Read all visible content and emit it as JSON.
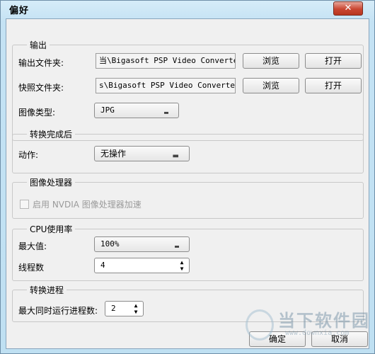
{
  "window": {
    "title": "偏好",
    "close_label": "✕"
  },
  "output": {
    "title": "输出",
    "output_folder_label": "输出文件夹:",
    "output_folder_value": "当\\Bigasoft PSP Video Converter",
    "snapshot_folder_label": "快照文件夹:",
    "snapshot_folder_value": "s\\Bigasoft PSP Video Converter",
    "browse_label": "浏览",
    "open_label": "打开",
    "image_type_label": "图像类型:",
    "image_type_value": "JPG"
  },
  "after_convert": {
    "title": "转换完成后",
    "action_label": "动作:",
    "action_value": "无操作"
  },
  "gpu": {
    "title": "图像处理器",
    "enable_label": "启用 NVDIA 图像处理器加速",
    "enabled": false
  },
  "cpu": {
    "title": "CPU使用率",
    "max_label": "最大值:",
    "max_value": "100%",
    "threads_label": "线程数",
    "threads_value": "4"
  },
  "process": {
    "title": "转换进程",
    "max_concurrent_label": "最大同时运行进程数:",
    "max_concurrent_value": "2"
  },
  "footer": {
    "ok_label": "确定",
    "cancel_label": "取消"
  },
  "watermark": {
    "text": "当下软件园",
    "url": "www.downxia.com"
  }
}
